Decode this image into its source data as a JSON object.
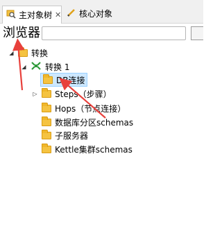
{
  "tabs": [
    {
      "label": "主对象树",
      "close": "✕",
      "icon": "magnifier-icon"
    },
    {
      "label": "核心对象",
      "icon": "pencil-icon"
    }
  ],
  "toolbar": {
    "browser_label": "浏览器",
    "search_value": "",
    "button_label": "[E"
  },
  "tree": {
    "root": {
      "label": "转换",
      "expander": "◢"
    },
    "trans": {
      "label": "转换 1",
      "expander": "◢"
    },
    "children": [
      {
        "label": "DB连接"
      },
      {
        "label": "Steps（步骤）",
        "expander": "▷"
      },
      {
        "label": "Hops（节点连接）"
      },
      {
        "label": "数据库分区schemas"
      },
      {
        "label": "子服务器"
      },
      {
        "label": "Kettle集群schemas"
      }
    ]
  },
  "colors": {
    "annotation_arrow": "#e8413c",
    "selection": "#cde8ff"
  }
}
